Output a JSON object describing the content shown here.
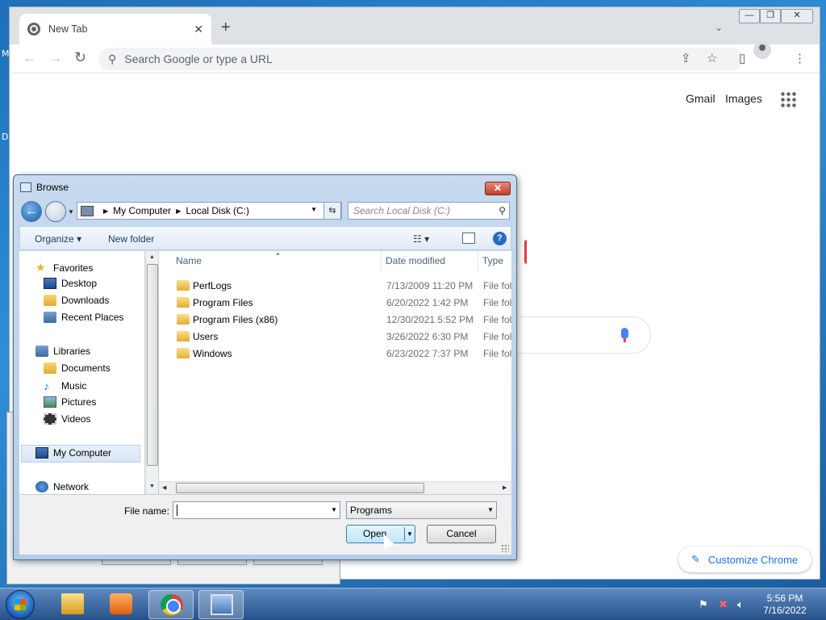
{
  "desktop": {
    "stub_1": "M",
    "stub_2": "D"
  },
  "chrome": {
    "tab_title": "New Tab",
    "tab_close": "✕",
    "new_tab": "+",
    "tab_search": "⌄",
    "omnibox_placeholder": "Search Google or type a URL",
    "top_links": {
      "gmail": "Gmail",
      "images": "Images"
    },
    "customize_label": "Customize Chrome",
    "window_controls": {
      "minimize": "—",
      "restore": "❐",
      "close": "✕"
    }
  },
  "dialog": {
    "title": "Browse",
    "close": "✕",
    "back_glyph": "←",
    "address": {
      "root": "My Computer",
      "folder": "Local Disk (C:)"
    },
    "search_placeholder": "Search Local Disk (C:)",
    "commands": {
      "organize": "Organize ▾",
      "new_folder": "New folder"
    },
    "help": "?",
    "nav": {
      "favorites": "Favorites",
      "desktop": "Desktop",
      "downloads": "Downloads",
      "recent": "Recent Places",
      "libraries": "Libraries",
      "documents": "Documents",
      "music": "Music",
      "pictures": "Pictures",
      "videos": "Videos",
      "my_computer": "My Computer",
      "network": "Network"
    },
    "columns": {
      "name": "Name",
      "date": "Date modified",
      "type": "Type"
    },
    "files": [
      {
        "name": "PerfLogs",
        "date": "7/13/2009 11:20 PM",
        "type": "File folder"
      },
      {
        "name": "Program Files",
        "date": "6/20/2022 1:42 PM",
        "type": "File folder"
      },
      {
        "name": "Program Files (x86)",
        "date": "12/30/2021 5:52 PM",
        "type": "File folder"
      },
      {
        "name": "Users",
        "date": "3/26/2022 6:30 PM",
        "type": "File folder"
      },
      {
        "name": "Windows",
        "date": "6/23/2022 7:37 PM",
        "type": "File folder"
      }
    ],
    "file_name_label": "File name:",
    "file_name_value": "",
    "filter": "Programs",
    "open_label": "Open",
    "cancel_label": "Cancel"
  },
  "taskbar": {
    "time": "5:56 PM",
    "date": "7/16/2022"
  },
  "colors": {
    "accent": "#1a73e8",
    "dialog_frame": "#b5cce6",
    "taskbar": "#27518a"
  }
}
